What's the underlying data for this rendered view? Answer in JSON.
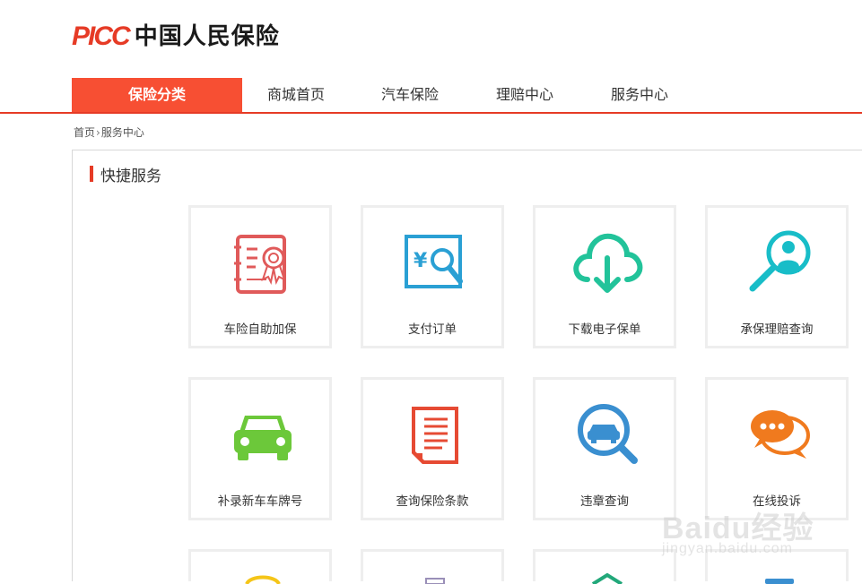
{
  "brand": {
    "logo_latin": "PICC",
    "logo_cn": "中国人民保险"
  },
  "nav": {
    "category_label": "保险分类",
    "items": [
      {
        "label": "商城首页"
      },
      {
        "label": "汽车保险"
      },
      {
        "label": "理赔中心"
      },
      {
        "label": "服务中心"
      }
    ]
  },
  "breadcrumb": {
    "home": "首页",
    "separator": "›",
    "current": "服务中心"
  },
  "section": {
    "title": "快捷服务"
  },
  "services": [
    {
      "label": "车险自助加保",
      "icon": "certificate-icon",
      "color": "#e05a5a"
    },
    {
      "label": "支付订单",
      "icon": "payment-search-icon",
      "color": "#2aa0d4"
    },
    {
      "label": "下载电子保单",
      "icon": "cloud-download-icon",
      "color": "#22c39a"
    },
    {
      "label": "承保理赔查询",
      "icon": "person-search-icon",
      "color": "#18bdc8"
    },
    {
      "label": "补录新车车牌号",
      "icon": "car-icon",
      "color": "#6cc83a"
    },
    {
      "label": "查询保险条款",
      "icon": "document-icon",
      "color": "#e64a33"
    },
    {
      "label": "违章查询",
      "icon": "car-search-icon",
      "color": "#3a8fd0"
    },
    {
      "label": "在线投诉",
      "icon": "chat-bubbles-icon",
      "color": "#f07a1e"
    }
  ],
  "watermark": {
    "text": "Baidu经验",
    "sub": "jingyan.baidu.com"
  },
  "colors": {
    "brand_red": "#e63b26",
    "nav_active": "#f74f33"
  }
}
